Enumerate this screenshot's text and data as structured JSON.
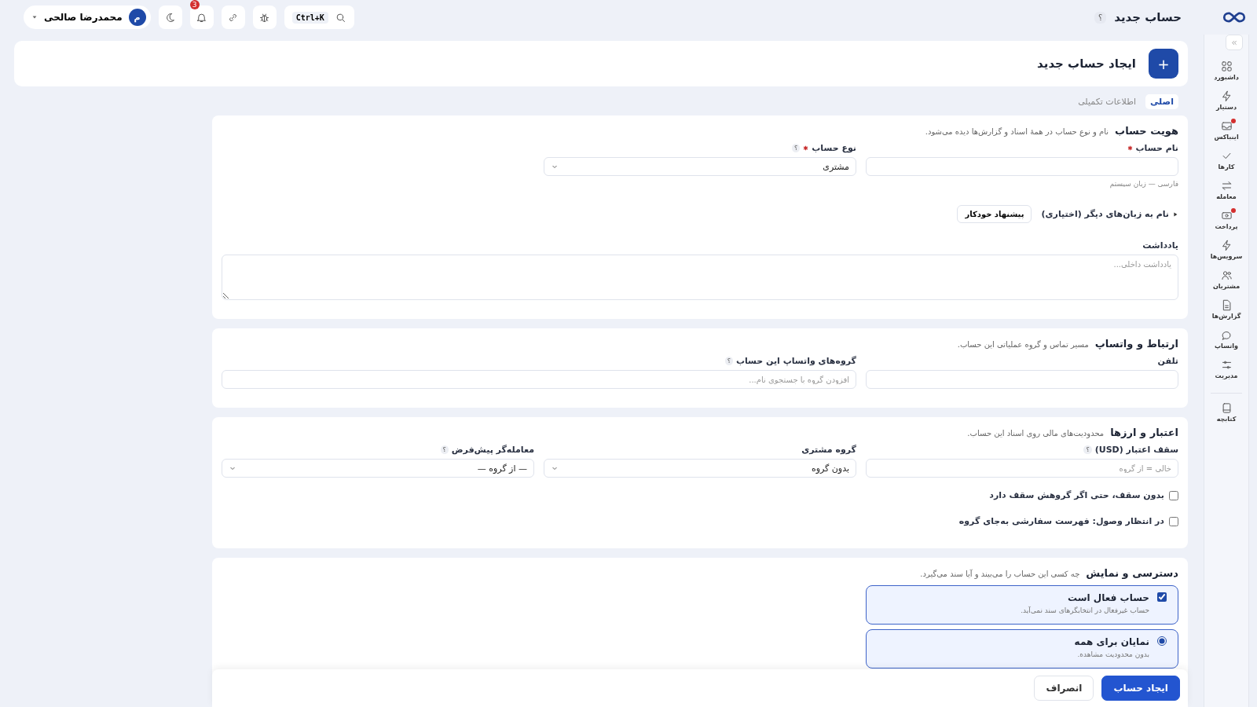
{
  "topbar": {
    "title": "حساب جدید",
    "help": "؟",
    "search_shortcut": "Ctrl+K",
    "notifications": "3",
    "user": {
      "name": "محمدرضا صالحی",
      "initial": "م"
    }
  },
  "sidebar": {
    "items": [
      {
        "label": "داشبورد",
        "dot": false
      },
      {
        "label": "دستیار",
        "dot": false
      },
      {
        "label": "اینباکس",
        "dot": true
      },
      {
        "label": "کارها",
        "dot": false
      },
      {
        "label": "معامله",
        "dot": false
      },
      {
        "label": "پرداخت",
        "dot": true
      },
      {
        "label": "سرویس‌ها",
        "dot": false
      },
      {
        "label": "مشتریان",
        "dot": false
      },
      {
        "label": "گزارش‌ها",
        "dot": false
      },
      {
        "label": "واتساپ",
        "dot": false
      },
      {
        "label": "مدیریت",
        "dot": false
      }
    ],
    "bottom_items": [
      {
        "label": "کتابچه",
        "dot": false
      }
    ]
  },
  "page_header": {
    "title": "ایجاد حساب جدید",
    "button": "+"
  },
  "tabs": [
    {
      "label": "اصلی",
      "selected": true
    },
    {
      "label": "اطلاعات تکمیلی",
      "selected": false
    }
  ],
  "sections": [
    {
      "title": "هویت حساب",
      "subtitle": "نام و نوع حساب در همهٔ اسناد و گزارش‌ها دیده می‌شود.",
      "rows": [
        [
          {
            "kind": "text",
            "label": "نام حساب",
            "required": true,
            "hint": "فارسی — زبان سیستم"
          },
          {
            "kind": "select",
            "label": "نوع حساب",
            "required": true,
            "help": "؟",
            "value": "مشتری"
          }
        ],
        [
          {
            "kind": "disclosure",
            "label": "نام به زبان‌های دیگر (اختیاری)",
            "expanded": false,
            "button": "پیشنهاد خودکار"
          }
        ],
        [
          {
            "kind": "textarea",
            "label": "یادداشت",
            "placeholder": "یادداشت داخلی..."
          }
        ]
      ]
    },
    {
      "title": "ارتباط و واتساپ",
      "subtitle": "مسیر تماس و گروه عملیاتی این حساب.",
      "rows": [
        [
          {
            "kind": "text",
            "label": "تلفن"
          },
          {
            "kind": "tags",
            "label": "گروه‌های واتساپ این حساب",
            "help": "؟",
            "placeholder": "افزودن گروه با جستجوی نام..."
          }
        ]
      ]
    },
    {
      "title": "اعتبار و ارزها",
      "subtitle": "محدودیت‌های مالی روی اسناد این حساب.",
      "rows": [
        [
          {
            "kind": "text",
            "label": "سقف اعتبار (USD)",
            "help": "؟",
            "placeholder": "خالی = از گروه"
          },
          {
            "kind": "select",
            "label": "گروه مشتری",
            "value": "بدون گروه"
          },
          {
            "kind": "select",
            "label": "معامله‌گر پیش‌فرض",
            "help": "؟",
            "value": "— از گروه —"
          }
        ],
        [
          {
            "kind": "checkbox",
            "label": "بدون سقف، حتی اگر گروهش سقف دارد",
            "checked": false
          }
        ],
        [
          {
            "kind": "checkbox",
            "label": "در انتظار وصول: فهرست سفارشی به‌جای گروه",
            "checked": false
          }
        ]
      ]
    },
    {
      "title": "دسترسی و نمایش",
      "subtitle": "چه کسی این حساب را می‌بیند و آیا سند می‌گیرد.",
      "rows": [
        [
          {
            "kind": "check-card",
            "label": "حساب فعال است",
            "description": "حساب غیرفعال در انتخابگرهای سند نمی‌آید.",
            "checked": true
          }
        ],
        [
          {
            "kind": "radio-card",
            "label": "نمایان برای همه",
            "description": "بدون محدودیت مشاهده.",
            "selected": true
          }
        ]
      ]
    }
  ],
  "footer": {
    "buttons": [
      {
        "label": "ایجاد حساب",
        "kind": "primary"
      },
      {
        "label": "انصراف",
        "kind": "secondary"
      }
    ]
  }
}
